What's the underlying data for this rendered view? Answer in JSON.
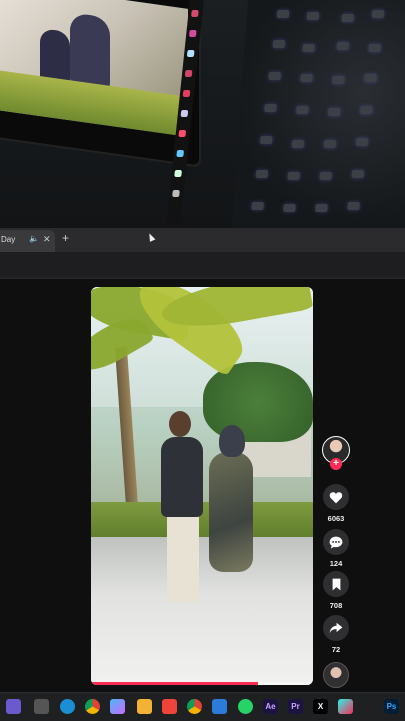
{
  "browser": {
    "tab": {
      "title": "Day",
      "audio_icon": "speaker-icon",
      "close_icon": "close-icon"
    },
    "new_tab_icon": "plus-icon"
  },
  "video": {
    "progress": 0.75,
    "progress_color": "#fe2c55"
  },
  "actions": {
    "follow_icon": "plus-icon",
    "likes": "6063",
    "comments": "124",
    "bookmarks": "708",
    "shares": "72"
  },
  "colors": {
    "accent": "#fe2c55",
    "background": "#0f0f10",
    "taskbar": "#1f2022"
  },
  "taskbar": {
    "icons": [
      {
        "name": "widgets-icon",
        "label": ""
      },
      {
        "name": "file-explorer-window-icon",
        "label": ""
      },
      {
        "name": "edge-icon",
        "label": ""
      },
      {
        "name": "chrome-icon",
        "label": ""
      },
      {
        "name": "copilot-icon",
        "label": ""
      },
      {
        "name": "folder-icon",
        "label": ""
      },
      {
        "name": "anydesk-icon",
        "label": ""
      },
      {
        "name": "chrome-alt-icon",
        "label": ""
      },
      {
        "name": "notes-app-icon",
        "label": ""
      },
      {
        "name": "whatsapp-icon",
        "label": ""
      },
      {
        "name": "after-effects-icon",
        "label": "Ae"
      },
      {
        "name": "premiere-pro-icon",
        "label": "Pr"
      },
      {
        "name": "x-icon",
        "label": "X"
      },
      {
        "name": "tiktok-icon",
        "label": ""
      },
      {
        "name": "photoshop-icon",
        "label": "Ps"
      }
    ]
  }
}
